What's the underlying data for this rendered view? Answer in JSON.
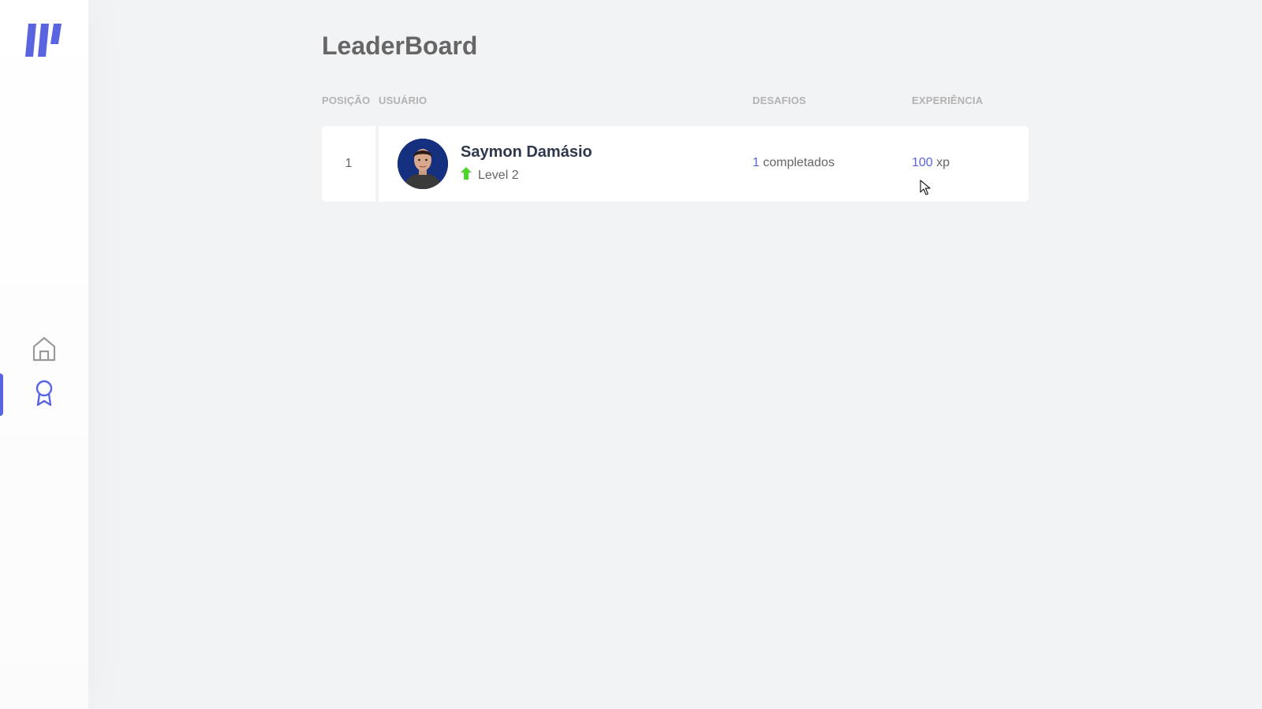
{
  "app": {
    "title": "LeaderBoard",
    "accent_color": "#5965e0",
    "level_up_color": "#4cd62b"
  },
  "sidebar": {
    "logo_icon": "move-it-logo",
    "items": [
      {
        "id": "home",
        "icon": "home-icon",
        "active": false
      },
      {
        "id": "leaderboard",
        "icon": "award-icon",
        "active": true
      }
    ]
  },
  "table": {
    "headers": {
      "position": "Posição",
      "user": "Usuário",
      "challenges": "Desafios",
      "experience": "Experiência"
    },
    "rows": [
      {
        "position": "1",
        "name": "Saymon Damásio",
        "level": "Level 2",
        "challenges_count": "1",
        "challenges_label": "completados",
        "xp_value": "100",
        "xp_unit": "xp"
      }
    ]
  }
}
